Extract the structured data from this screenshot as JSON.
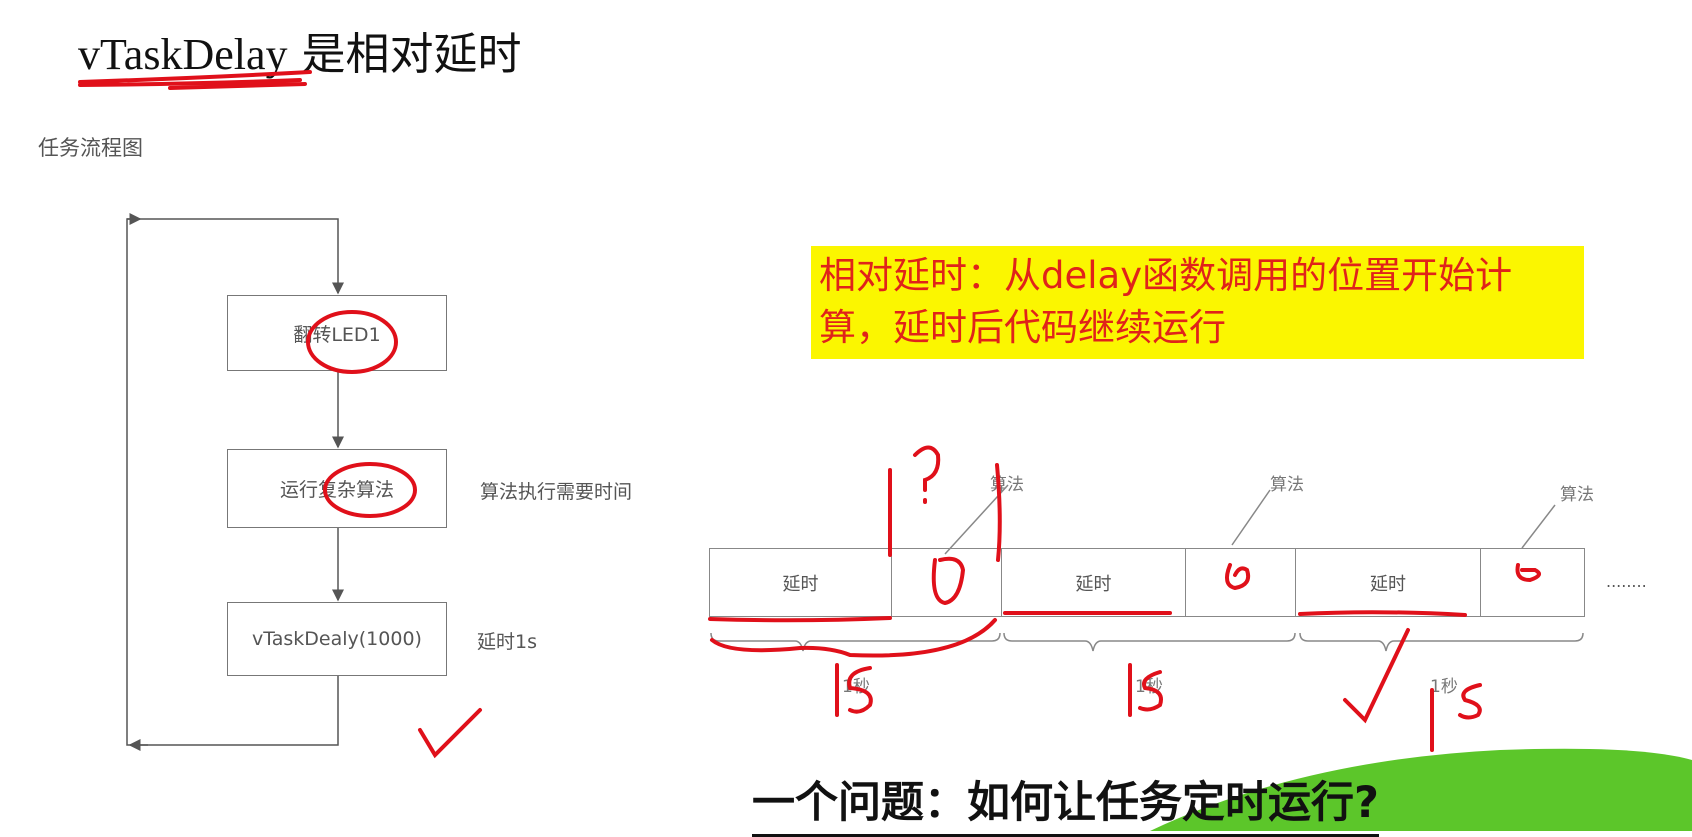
{
  "title": {
    "code": "vTaskDelay",
    "text": " 是相对延时"
  },
  "subtitle": "任务流程图",
  "flowchart": {
    "steps": [
      "翻转LED1",
      "运行复杂算法",
      "vTaskDealy(1000)"
    ],
    "notes": [
      "算法执行需要时间",
      "延时1s"
    ]
  },
  "highlight": "相对延时：从delay函数调用的位置开始计算，延时后代码继续运行",
  "timeline": {
    "segments": [
      "延时",
      "",
      "延时",
      "",
      "延时",
      ""
    ],
    "callout": "算法",
    "period": "1秒",
    "ellipsis": "........"
  },
  "question": "一个问题：如何让任务定时运行?",
  "colors": {
    "annotation": "#e0101a",
    "highlight": "#fbf600",
    "accent_green": "#5cc62a"
  }
}
